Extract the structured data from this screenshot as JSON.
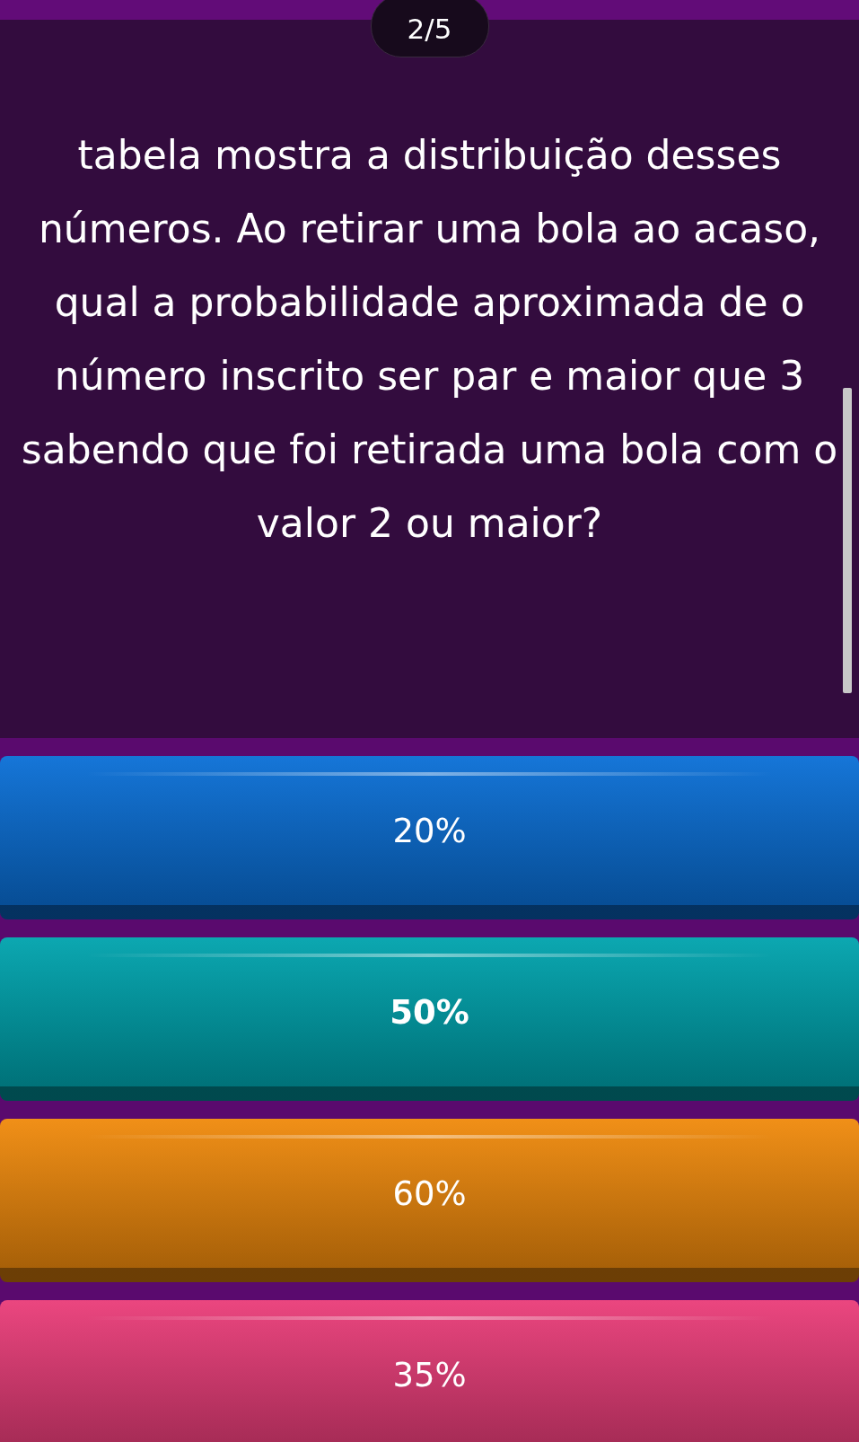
{
  "progress": "2/5",
  "question": "tabela mostra a distribuição desses números. Ao retirar uma bola ao acaso, qual a probabilidade aproximada de o número inscrito ser par e maior que 3 sabendo que foi retirada uma bola com o valor 2 ou maior?",
  "answers": [
    {
      "label": "20%",
      "color": "#0a6fd6",
      "selected": false
    },
    {
      "label": "50%",
      "color": "#00a3ad",
      "selected": true
    },
    {
      "label": "60%",
      "color": "#f08a0c",
      "selected": false
    },
    {
      "label": "35%",
      "color": "#ea3d79",
      "selected": false
    }
  ]
}
